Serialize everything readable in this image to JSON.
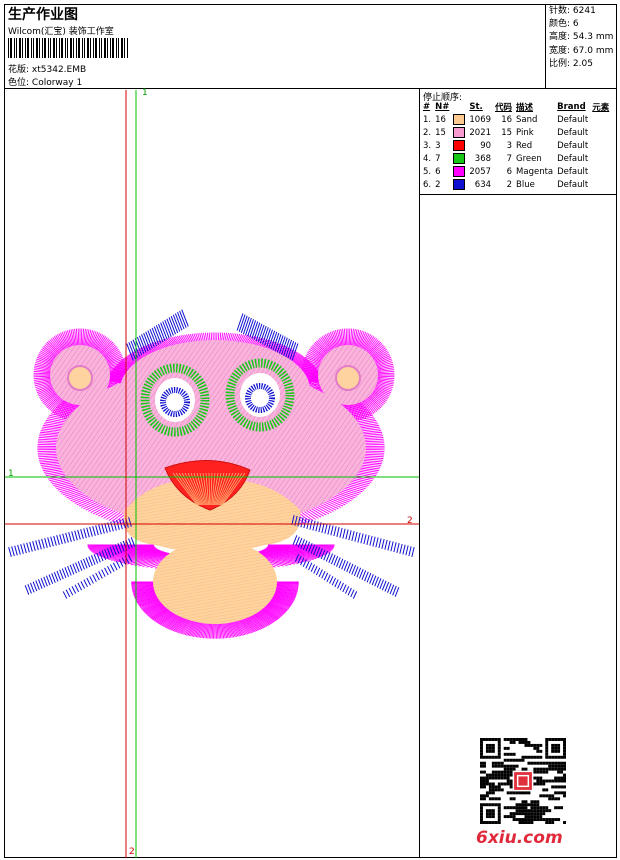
{
  "header": {
    "title": "生产作业图",
    "company": "Wilcom(汇宝) 装饰工作室",
    "design_label": "花版:",
    "design_value": "xt5342.EMB",
    "colorway_label": "色位:",
    "colorway_value": "Colorway 1"
  },
  "specs": [
    {
      "label": "针数:",
      "value": "6241"
    },
    {
      "label": "颜色:",
      "value": "6"
    },
    {
      "label": "高度:",
      "value": "54.3 mm"
    },
    {
      "label": "宽度:",
      "value": "67.0 mm"
    },
    {
      "label": "比例:",
      "value": "2.05"
    }
  ],
  "stop_sequence": {
    "title": "停止顺序:",
    "headers": [
      "#",
      "N#",
      "St.",
      "代码",
      "描述",
      "Brand",
      "元素"
    ],
    "rows": [
      {
        "idx": "1.",
        "n": "16",
        "st": "1069",
        "code": "16",
        "desc": "Sand",
        "brand": "Default",
        "color": "#ffc990"
      },
      {
        "idx": "2.",
        "n": "15",
        "st": "2021",
        "code": "15",
        "desc": "Pink",
        "brand": "Default",
        "color": "#f79ad0"
      },
      {
        "idx": "3.",
        "n": "3",
        "st": "90",
        "code": "3",
        "desc": "Red",
        "brand": "Default",
        "color": "#ff0000"
      },
      {
        "idx": "4.",
        "n": "7",
        "st": "368",
        "code": "7",
        "desc": "Green",
        "brand": "Default",
        "color": "#18c818"
      },
      {
        "idx": "5.",
        "n": "6",
        "st": "2057",
        "code": "6",
        "desc": "Magenta",
        "brand": "Default",
        "color": "#ff00ff"
      },
      {
        "idx": "6.",
        "n": "2",
        "st": "634",
        "code": "2",
        "desc": "Blue",
        "brand": "Default",
        "color": "#1010d0"
      }
    ]
  },
  "axes": {
    "green_top": "1",
    "green_left": "1",
    "red_right": "2",
    "red_bottom": "2"
  },
  "colors": {
    "sand": "#ffc990",
    "pink": "#f79ad0",
    "red": "#ff0000",
    "green": "#18c818",
    "magenta": "#ff00ff",
    "blue": "#1010d0"
  },
  "watermark": {
    "text": "6xiu.com",
    "icon": "qr-code-icon"
  }
}
